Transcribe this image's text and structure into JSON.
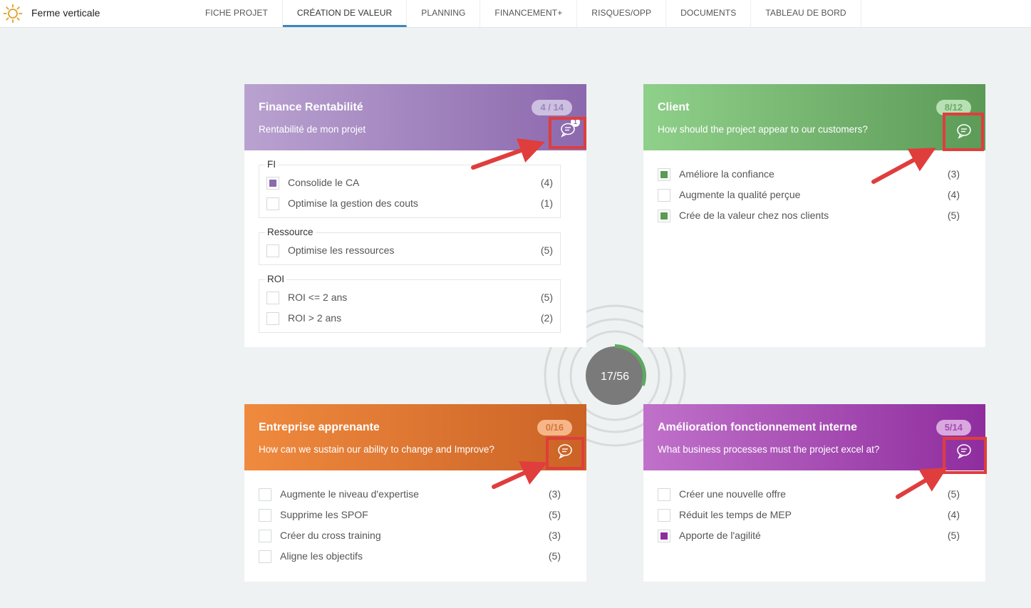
{
  "app": {
    "title": "Ferme verticale",
    "logo_icon": "sun-icon"
  },
  "tabs": [
    {
      "label": "FICHE PROJET",
      "active": false
    },
    {
      "label": "CRÉATION DE VALEUR",
      "active": true
    },
    {
      "label": "PLANNING",
      "active": false
    },
    {
      "label": "FINANCEMENT+",
      "active": false
    },
    {
      "label": "RISQUES/OPP",
      "active": false
    },
    {
      "label": "DOCUMENTS",
      "active": false
    },
    {
      "label": "TABLEAU DE BORD",
      "active": false
    }
  ],
  "colors": {
    "finance_gradient": [
      "#b9a2d0",
      "#8c68ad"
    ],
    "client_gradient": [
      "#8fd08a",
      "#5c9a57"
    ],
    "entreprise_gradient": [
      "#ef8a3e",
      "#cb6326"
    ],
    "amelioration_gradient": [
      "#c071ca",
      "#8f2d9e"
    ],
    "finance_check": "#8c68ad",
    "client_check": "#5c9a57",
    "amelioration_check": "#8f2d9e",
    "progress": "#5fa862",
    "highlight": "#e03d3d"
  },
  "cards": {
    "finance": {
      "title": "Finance Rentabilité",
      "subtitle": "Rentabilité de mon projet",
      "badge": "4 / 14",
      "comment_count": "1",
      "groups": [
        {
          "label": "FI",
          "items": [
            {
              "label": "Consolide le CA",
              "count": "(4)",
              "checked": true
            },
            {
              "label": "Optimise la gestion des couts",
              "count": "(1)",
              "checked": false
            }
          ]
        },
        {
          "label": "Ressource",
          "items": [
            {
              "label": "Optimise les ressources",
              "count": "(5)",
              "checked": false
            }
          ]
        },
        {
          "label": "ROI",
          "items": [
            {
              "label": "ROI <= 2 ans",
              "count": "(5)",
              "checked": false
            },
            {
              "label": "ROI > 2 ans",
              "count": "(2)",
              "checked": false
            }
          ]
        }
      ]
    },
    "client": {
      "title": "Client",
      "subtitle": "How should the project appear to our customers?",
      "badge": "8/12",
      "items": [
        {
          "label": "Améliore la confiance",
          "count": "(3)",
          "checked": true
        },
        {
          "label": "Augmente la qualité perçue",
          "count": "(4)",
          "checked": false
        },
        {
          "label": "Crée de la valeur chez nos clients",
          "count": "(5)",
          "checked": true
        }
      ]
    },
    "entreprise": {
      "title": "Entreprise apprenante",
      "subtitle": "How can we sustain our ability to change and Improve?",
      "badge": "0/16",
      "items": [
        {
          "label": "Augmente le niveau d'expertise",
          "count": "(3)",
          "checked": false
        },
        {
          "label": "Supprime les SPOF",
          "count": "(5)",
          "checked": false
        },
        {
          "label": "Créer du cross training",
          "count": "(3)",
          "checked": false
        },
        {
          "label": "Aligne les objectifs",
          "count": "(5)",
          "checked": false
        }
      ]
    },
    "amelioration": {
      "title": "Amélioration fonctionnement interne",
      "subtitle": "What business processes must the project excel at?",
      "badge": "5/14",
      "items": [
        {
          "label": "Créer une nouvelle offre",
          "count": "(5)",
          "checked": false
        },
        {
          "label": "Réduit les temps de MEP",
          "count": "(4)",
          "checked": false
        },
        {
          "label": "Apporte de l'agilité",
          "count": "(5)",
          "checked": true
        }
      ]
    }
  },
  "progress": {
    "label": "17/56",
    "fraction": 0.3036
  }
}
